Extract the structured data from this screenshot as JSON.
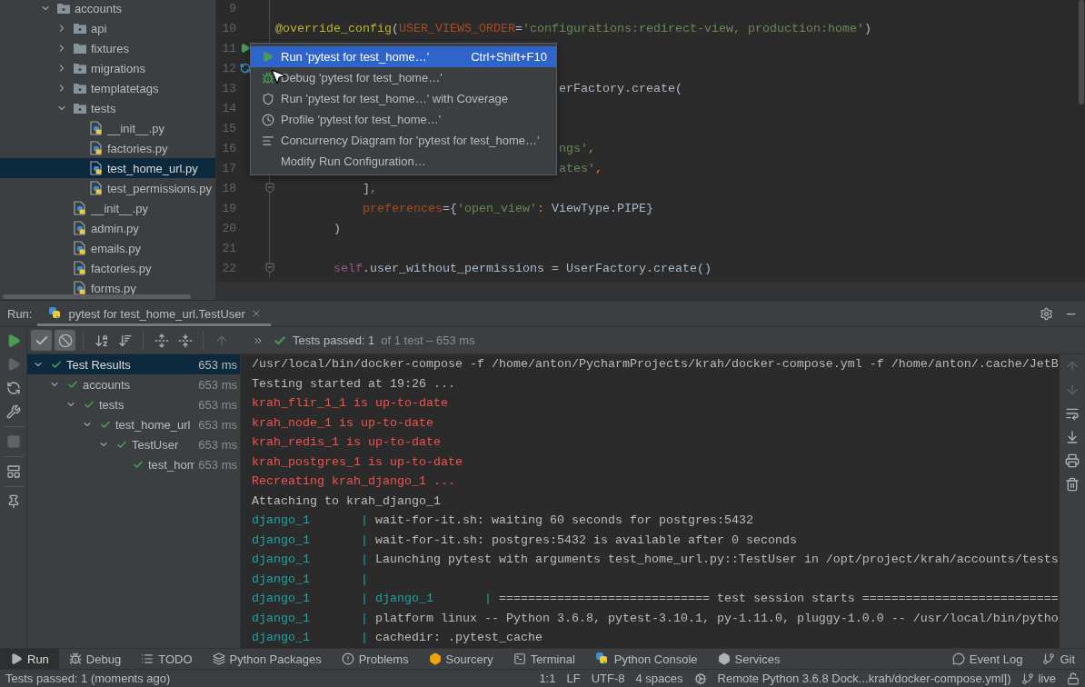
{
  "project_tree": [
    {
      "label": "accounts",
      "kind": "package",
      "expanded": true,
      "selected": false,
      "children": [
        {
          "label": "api",
          "kind": "package",
          "expanded": false,
          "selected": false
        },
        {
          "label": "fixtures",
          "kind": "folder",
          "expanded": false,
          "selected": false
        },
        {
          "label": "migrations",
          "kind": "package",
          "expanded": false,
          "selected": false
        },
        {
          "label": "templatetags",
          "kind": "package",
          "expanded": false,
          "selected": false
        },
        {
          "label": "tests",
          "kind": "package",
          "expanded": true,
          "selected": false,
          "children": [
            {
              "label": "__init__.py",
              "kind": "python",
              "selected": false
            },
            {
              "label": "factories.py",
              "kind": "python",
              "selected": false
            },
            {
              "label": "test_home_url.py",
              "kind": "python",
              "selected": true
            },
            {
              "label": "test_permissions.py",
              "kind": "python",
              "selected": false
            }
          ]
        },
        {
          "label": "__init__.py",
          "kind": "python",
          "selected": false
        },
        {
          "label": "admin.py",
          "kind": "python",
          "selected": false
        },
        {
          "label": "emails.py",
          "kind": "python",
          "selected": false
        },
        {
          "label": "factories.py",
          "kind": "python",
          "selected": false
        },
        {
          "label": "forms.py",
          "kind": "python",
          "selected": false
        }
      ]
    }
  ],
  "editor": {
    "lines": [
      {
        "number": "9",
        "kind": "plain"
      },
      {
        "number": "10",
        "kind": "plain",
        "tokens": [
          {
            "kind": "decorator",
            "text": "@override_config"
          },
          {
            "kind": "plain",
            "text": "("
          },
          {
            "kind": "param",
            "text": "USER_VIEWS_ORDER"
          },
          {
            "kind": "plain",
            "text": "="
          },
          {
            "kind": "string",
            "text": "'configurations:redirect-view, production:home'"
          },
          {
            "kind": "plain",
            "text": ")"
          }
        ]
      },
      {
        "number": "11",
        "kind": "run"
      },
      {
        "number": "12",
        "kind": "rerun"
      },
      {
        "number": "13",
        "kind": "plain",
        "tokens": [
          {
            "kind": "plain",
            "text": "erFactory.create("
          }
        ]
      },
      {
        "number": "14",
        "kind": "plain"
      },
      {
        "number": "15",
        "kind": "plain"
      },
      {
        "number": "16",
        "kind": "plain",
        "tokens": [
          {
            "kind": "string",
            "text": "ngs'"
          },
          {
            "kind": "punct",
            "text": ","
          }
        ]
      },
      {
        "number": "17",
        "kind": "plain",
        "tokens": [
          {
            "kind": "string",
            "text": "ates'"
          },
          {
            "kind": "punct",
            "text": ","
          }
        ]
      },
      {
        "number": "18",
        "kind": "fold",
        "tokens": [
          {
            "kind": "plain",
            "text": "]"
          },
          {
            "kind": "punct",
            "text": ","
          }
        ]
      },
      {
        "number": "19",
        "kind": "plain",
        "tokens": [
          {
            "kind": "param",
            "text": "preferences"
          },
          {
            "kind": "plain",
            "text": "={"
          },
          {
            "kind": "string",
            "text": "'open_view'"
          },
          {
            "kind": "punct",
            "text": ":"
          },
          {
            "kind": "plain",
            "text": " ViewType.PIPE}"
          }
        ]
      },
      {
        "number": "20",
        "kind": "plain",
        "tokens": [
          {
            "kind": "plain",
            "text": ")"
          }
        ]
      },
      {
        "number": "21",
        "kind": "plain"
      },
      {
        "number": "22",
        "kind": "fold",
        "tokens": [
          {
            "kind": "self",
            "text": "self"
          },
          {
            "kind": "plain",
            "text": ".user_without_permissions = UserFactory.create()"
          }
        ]
      }
    ]
  },
  "context_menu": {
    "items": [
      {
        "label": "Run 'pytest for test_home…'",
        "kind": "run",
        "shortcut": "Ctrl+Shift+F10",
        "selected": true
      },
      {
        "label": "Debug 'pytest for test_home…'",
        "kind": "debug",
        "selected": false
      },
      {
        "label": "Run 'pytest for test_home…' with Coverage",
        "kind": "coverage",
        "selected": false
      },
      {
        "label": "Profile 'pytest for test_home…'",
        "kind": "profile",
        "selected": false
      },
      {
        "label": "Concurrency Diagram for 'pytest for test_home…'",
        "kind": "concurrency",
        "selected": false
      },
      {
        "label": "Modify Run Configuration…",
        "kind": "plain",
        "selected": false
      }
    ]
  },
  "run_panel": {
    "label": "Run:",
    "tab": {
      "title": "pytest for test_home_url.TestUser",
      "selected": true
    },
    "side_actions": [
      [
        {
          "kind": "run",
          "disabled": false
        },
        {
          "kind": "rerun-failed",
          "disabled": true
        },
        {
          "kind": "auto-test",
          "disabled": false
        },
        {
          "kind": "settings",
          "disabled": false
        }
      ],
      [
        {
          "kind": "stop",
          "disabled": true
        }
      ],
      [
        {
          "kind": "layout",
          "disabled": false
        }
      ],
      [
        {
          "kind": "pin",
          "disabled": false
        }
      ]
    ],
    "toolbar": [
      [
        {
          "kind": "show-passed",
          "on": true,
          "disabled": false
        },
        {
          "kind": "show-ignored",
          "on": true,
          "disabled": false
        }
      ],
      [
        {
          "kind": "sort-alpha",
          "disabled": false
        },
        {
          "kind": "sort-duration",
          "disabled": false
        }
      ],
      [
        {
          "kind": "expand-all",
          "disabled": false
        },
        {
          "kind": "collapse-all",
          "disabled": false
        }
      ],
      [
        {
          "kind": "previous",
          "disabled": true
        }
      ]
    ],
    "status": "Tests passed: 1",
    "status_detail": "of 1 test – 653 ms",
    "tests": [
      {
        "label": "Test Results",
        "time": "653 ms",
        "passed": true,
        "expanded": true,
        "selected": true,
        "children": [
          {
            "label": "accounts",
            "time": "653 ms",
            "passed": true,
            "expanded": true,
            "selected": false,
            "children": [
              {
                "label": "tests",
                "time": "653 ms",
                "passed": true,
                "expanded": true,
                "selected": false,
                "children": [
                  {
                    "label": "test_home_url",
                    "time": "653 ms",
                    "passed": true,
                    "expanded": true,
                    "selected": false,
                    "children": [
                      {
                        "label": "TestUser",
                        "time": "653 ms",
                        "passed": true,
                        "expanded": true,
                        "selected": false,
                        "children": [
                          {
                            "label": "test_hom",
                            "time": "653 ms",
                            "passed": true,
                            "selected": false
                          }
                        ]
                      }
                    ]
                  }
                ]
              }
            ]
          }
        ]
      }
    ],
    "console": [
      [
        {
          "kind": "plain",
          "text": "/usr/local/bin/docker-compose -f /home/anton/PycharmProjects/krah/docker-compose.yml -f /home/anton/.cache/JetB"
        }
      ],
      [
        {
          "kind": "plain",
          "text": "Testing started at 19:26 ..."
        }
      ],
      [
        {
          "kind": "error",
          "text": "krah_flir_1_1 is up-to-date"
        }
      ],
      [
        {
          "kind": "error",
          "text": "krah_node_1 is up-to-date"
        }
      ],
      [
        {
          "kind": "error",
          "text": "krah_redis_1 is up-to-date"
        }
      ],
      [
        {
          "kind": "error",
          "text": "krah_postgres_1 is up-to-date"
        }
      ],
      [
        {
          "kind": "error",
          "text": "Recreating krah_django_1 ..."
        }
      ],
      [
        {
          "kind": "plain",
          "text": "Attaching to krah_django_1"
        }
      ],
      [
        {
          "kind": "service",
          "text": "django_1       | "
        },
        {
          "kind": "plain",
          "text": "wait-for-it.sh: waiting 60 seconds for postgres:5432"
        }
      ],
      [
        {
          "kind": "service",
          "text": "django_1       | "
        },
        {
          "kind": "plain",
          "text": "wait-for-it.sh: postgres:5432 is available after 0 seconds"
        }
      ],
      [
        {
          "kind": "service",
          "text": "django_1       | "
        },
        {
          "kind": "plain",
          "text": "Launching pytest with arguments test_home_url.py::TestUser in /opt/project/krah/accounts/tests"
        }
      ],
      [
        {
          "kind": "service",
          "text": "django_1       |"
        }
      ],
      [
        {
          "kind": "service",
          "text": "django_1       | django_1       | "
        },
        {
          "kind": "plain",
          "text": "============================= test session starts ==========================="
        }
      ],
      [
        {
          "kind": "service",
          "text": "django_1       | "
        },
        {
          "kind": "plain",
          "text": "platform linux -- Python 3.6.8, pytest-3.10.1, py-1.11.0, pluggy-1.0.0 -- /usr/local/bin/pytho"
        }
      ],
      [
        {
          "kind": "service",
          "text": "django_1       | "
        },
        {
          "kind": "plain",
          "text": "cachedir: .pytest_cache"
        }
      ]
    ],
    "end_actions": [
      {
        "kind": "up",
        "disabled": true
      },
      {
        "kind": "down",
        "disabled": true
      },
      {
        "kind": "soft-wrap",
        "disabled": false
      },
      {
        "kind": "scroll-end",
        "disabled": false
      },
      {
        "kind": "print",
        "disabled": false
      },
      {
        "kind": "clear",
        "disabled": false
      }
    ]
  },
  "tool_windows": {
    "left": [
      {
        "label": "Run",
        "kind": "run",
        "selected": true
      },
      {
        "label": "Debug",
        "kind": "debug",
        "selected": false
      },
      {
        "label": "TODO",
        "kind": "todo",
        "selected": false
      },
      {
        "label": "Python Packages",
        "kind": "packages",
        "selected": false
      },
      {
        "label": "Problems",
        "kind": "problems",
        "selected": false
      },
      {
        "label": "Sourcery",
        "kind": "sourcery",
        "selected": false
      },
      {
        "label": "Terminal",
        "kind": "terminal",
        "selected": false
      },
      {
        "label": "Python Console",
        "kind": "python-console",
        "selected": false
      },
      {
        "label": "Services",
        "kind": "services",
        "selected": false
      }
    ],
    "right": [
      {
        "label": "Event Log",
        "kind": "event-log",
        "selected": false
      },
      {
        "label": "Git",
        "kind": "git",
        "selected": false
      }
    ]
  },
  "status_bar": {
    "message": "Tests passed: 1 (moments ago)",
    "items": [
      {
        "kind": "text",
        "text": "1:1"
      },
      {
        "kind": "text",
        "text": "LF"
      },
      {
        "kind": "text",
        "text": "UTF-8"
      },
      {
        "kind": "text",
        "text": "4 spaces"
      },
      {
        "kind": "interpreter"
      },
      {
        "kind": "text",
        "text": "Remote Python 3.6.8 Dock...krah/docker-compose.yml])"
      },
      {
        "kind": "branch",
        "text": "live"
      },
      {
        "kind": "lock"
      }
    ]
  }
}
